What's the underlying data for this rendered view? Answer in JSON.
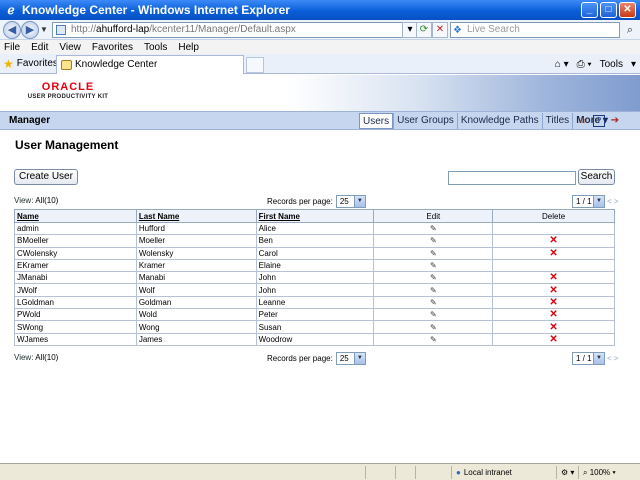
{
  "window": {
    "title": "Knowledge Center - Windows Internet Explorer",
    "minimize": "_",
    "maximize": "□",
    "close": "✕"
  },
  "address_bar": {
    "url_prefix": "http://",
    "url_host": "ahufford-lap",
    "url_path": "/kcenter11/Manager/Default.aspx",
    "search_placeholder": "Live Search"
  },
  "menu": [
    "File",
    "Edit",
    "View",
    "Favorites",
    "Tools",
    "Help"
  ],
  "tabs": {
    "favorites_label": "Favorites",
    "active_tab": "Knowledge Center",
    "tools_label": "Tools"
  },
  "brand": {
    "logo_top": "ORACLE",
    "logo_bottom": "USER PRODUCTIVITY KIT"
  },
  "manager": {
    "title": "Manager",
    "nav": [
      "Users",
      "User Groups",
      "Knowledge Paths",
      "Titles",
      "More ▾"
    ],
    "active_nav": "Users"
  },
  "page": {
    "title": "User Management",
    "create_button": "Create User",
    "search_value": "",
    "search_button": "Search",
    "view_all_label": "View: ",
    "view_all_link": "All(10)",
    "records_label": "Records per page:",
    "records_value": "25",
    "pager_value": "1 / 1",
    "pager_arrows": "< >"
  },
  "table": {
    "columns": [
      "Name",
      "Last Name",
      "First Name",
      "Edit",
      "Delete"
    ],
    "rows": [
      {
        "name": "admin",
        "last": "Hufford",
        "first": "Alice",
        "deletable": false
      },
      {
        "name": "BMoeller",
        "last": "Moeller",
        "first": "Ben",
        "deletable": true
      },
      {
        "name": "CWolensky",
        "last": "Wolensky",
        "first": "Carol",
        "deletable": true
      },
      {
        "name": "EKramer",
        "last": "Kramer",
        "first": "Elaine",
        "deletable": false
      },
      {
        "name": "JManabi",
        "last": "Manabi",
        "first": "John",
        "deletable": true
      },
      {
        "name": "JWolf",
        "last": "Wolf",
        "first": "John",
        "deletable": true
      },
      {
        "name": "LGoldman",
        "last": "Goldman",
        "first": "Leanne",
        "deletable": true
      },
      {
        "name": "PWold",
        "last": "Wold",
        "first": "Peter",
        "deletable": true
      },
      {
        "name": "SWong",
        "last": "Wong",
        "first": "Susan",
        "deletable": true
      },
      {
        "name": "WJames",
        "last": "James",
        "first": "Woodrow",
        "deletable": true
      }
    ]
  },
  "status": {
    "zone": "Local intranet",
    "zoom": "100%"
  },
  "colors": {
    "titlebar": "#0a5fd8",
    "manager_bar": "#c6d6ee",
    "delete_red": "#d9000f",
    "oracle_red": "#e3000f"
  }
}
